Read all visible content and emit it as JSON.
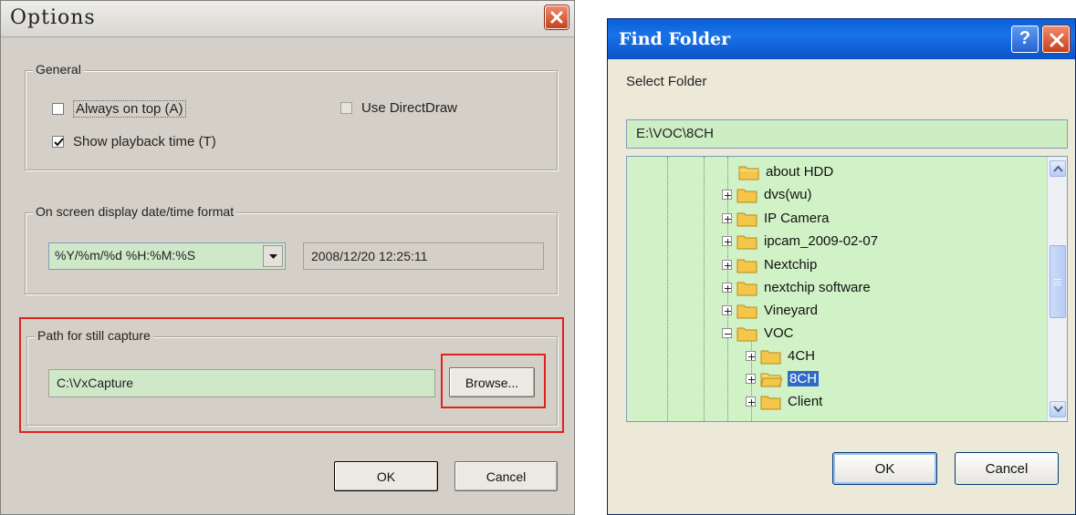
{
  "options": {
    "title": "Options",
    "general": {
      "label": "General",
      "always_on_top": "Always on top (A)",
      "use_directdraw": "Use DirectDraw",
      "show_playback_time": "Show playback time (T)"
    },
    "osd": {
      "label": "On screen display date/time format",
      "format_value": "%Y/%m/%d %H:%M:%S",
      "preview": "2008/12/20 12:25:11"
    },
    "capture": {
      "label": "Path for still capture",
      "path": "C:\\VxCapture",
      "browse_label": "Browse..."
    },
    "ok_label": "OK",
    "cancel_label": "Cancel"
  },
  "find_folder": {
    "title": "Find Folder",
    "help_label": "?",
    "select_label": "Select Folder",
    "path": "E:\\VOC\\8CH",
    "tree": {
      "items": [
        {
          "label": "about  HDD"
        },
        {
          "label": "dvs(wu)"
        },
        {
          "label": "IP Camera"
        },
        {
          "label": "ipcam_2009-02-07"
        },
        {
          "label": "Nextchip"
        },
        {
          "label": "nextchip software"
        },
        {
          "label": "Vineyard"
        },
        {
          "label": "VOC"
        },
        {
          "label": "4CH"
        },
        {
          "label": "8CH"
        },
        {
          "label": "Client"
        }
      ]
    },
    "ok_label": "OK",
    "cancel_label": "Cancel"
  },
  "colors": {
    "highlight_red": "#e0211f",
    "field_green": "#cfe9c8",
    "tree_green": "#d1f2c6",
    "xp_title_blue": "#0a5fd8",
    "selection_blue": "#316ac5"
  },
  "icons": [
    "close-icon",
    "help-icon",
    "checkmark-icon",
    "dropdown-arrow-icon",
    "folder-icon",
    "expand-plus-icon",
    "collapse-minus-icon",
    "scroll-up-icon",
    "scroll-down-icon"
  ]
}
